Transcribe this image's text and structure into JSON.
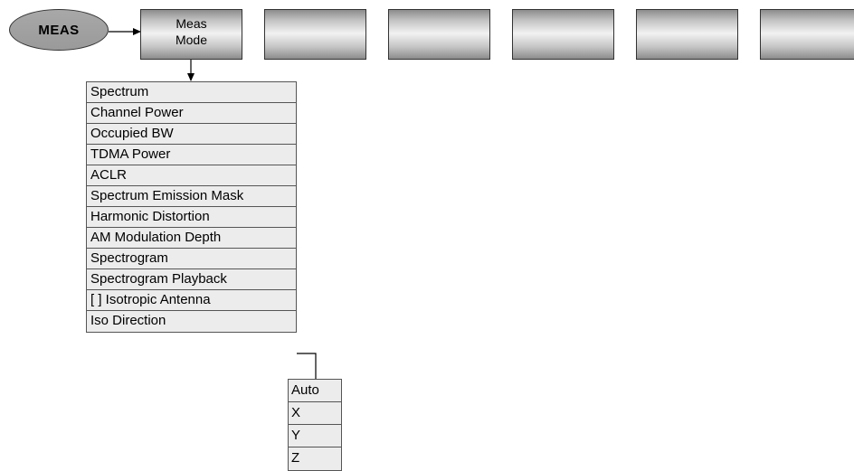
{
  "meas_key": {
    "label": "MEAS"
  },
  "softkeys": [
    {
      "label": "Meas\nMode"
    },
    {
      "label": ""
    },
    {
      "label": ""
    },
    {
      "label": ""
    },
    {
      "label": ""
    },
    {
      "label": ""
    }
  ],
  "meas_mode_menu": {
    "items": [
      "Spectrum",
      "Channel Power",
      "Occupied BW",
      "TDMA Power",
      "ACLR",
      "Spectrum Emission Mask",
      "Harmonic Distortion",
      "AM Modulation Depth",
      "Spectrogram",
      "Spectrogram Playback",
      "[ ] Isotropic Antenna",
      "Iso Direction"
    ]
  },
  "iso_direction_menu": {
    "items": [
      "Auto",
      "X",
      "Y",
      "Z"
    ]
  }
}
